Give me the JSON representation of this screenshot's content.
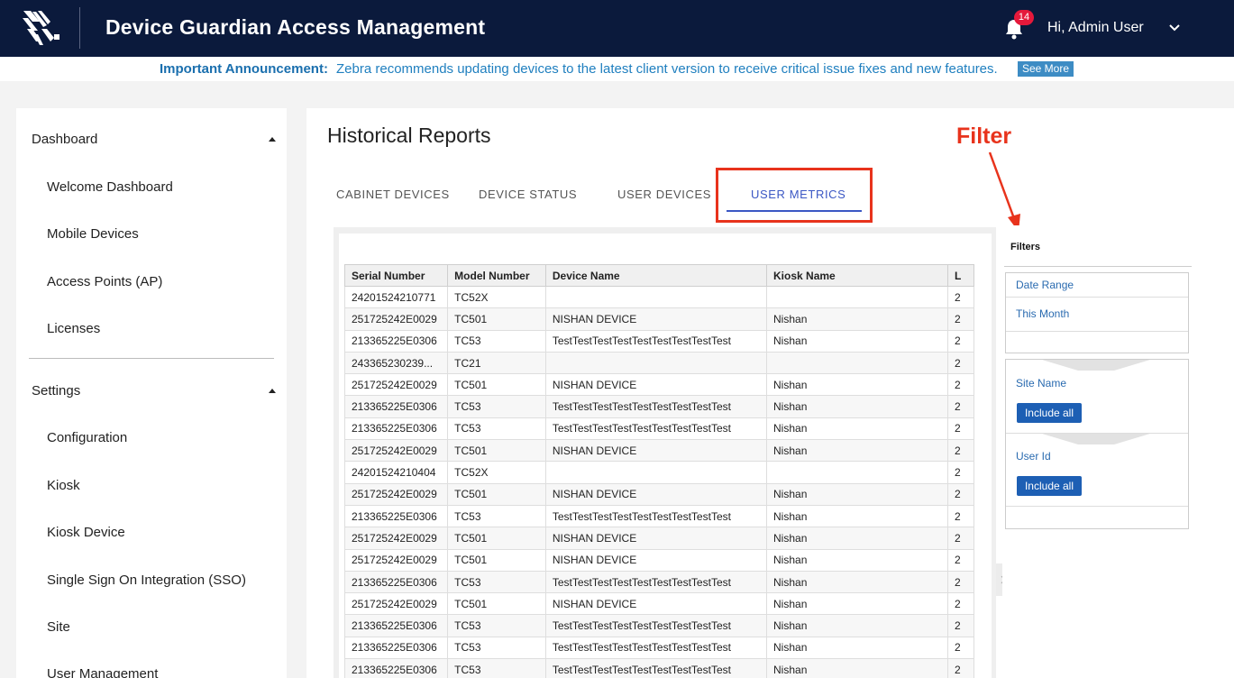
{
  "header": {
    "app_title": "Device Guardian Access Management",
    "notification_count": "14",
    "user_greeting": "Hi, Admin User",
    "logo_icon": "zebra-logo-icon"
  },
  "announcement": {
    "label": "Important Announcement:",
    "message": "Zebra recommends updating devices to the latest client version to receive critical issue fixes and new features.",
    "button": "See More"
  },
  "sidebar": {
    "dashboard_group": "Dashboard",
    "dashboard_items": [
      "Welcome Dashboard",
      "Mobile Devices",
      "Access Points (AP)",
      "Licenses"
    ],
    "settings_group": "Settings",
    "settings_items": [
      "Configuration",
      "Kiosk",
      "Kiosk Device",
      "Single Sign On Integration (SSO)",
      "Site",
      "User Management"
    ]
  },
  "main": {
    "page_title": "Historical Reports",
    "tabs": [
      "CABINET DEVICES",
      "DEVICE STATUS",
      "USER DEVICES",
      "USER METRICS"
    ],
    "active_tab": "USER METRICS",
    "annotation": "Filter"
  },
  "table": {
    "columns": [
      "Serial Number",
      "Model Number",
      "Device Name",
      "Kiosk Name",
      "L"
    ],
    "rows": [
      [
        "24201524210771",
        "TC52X",
        "",
        "",
        "2"
      ],
      [
        "251725242E0029",
        "TC501",
        "NISHAN DEVICE",
        "Nishan",
        "2"
      ],
      [
        "213365225E0306",
        "TC53",
        "TestTestTestTestTestTestTestTestTest",
        "Nishan",
        "2"
      ],
      [
        "243365230239...",
        "TC21",
        "",
        "",
        "2"
      ],
      [
        "251725242E0029",
        "TC501",
        "NISHAN DEVICE",
        "Nishan",
        "2"
      ],
      [
        "213365225E0306",
        "TC53",
        "TestTestTestTestTestTestTestTestTest",
        "Nishan",
        "2"
      ],
      [
        "213365225E0306",
        "TC53",
        "TestTestTestTestTestTestTestTestTest",
        "Nishan",
        "2"
      ],
      [
        "251725242E0029",
        "TC501",
        "NISHAN DEVICE",
        "Nishan",
        "2"
      ],
      [
        "24201524210404",
        "TC52X",
        "",
        "",
        "2"
      ],
      [
        "251725242E0029",
        "TC501",
        "NISHAN DEVICE",
        "Nishan",
        "2"
      ],
      [
        "213365225E0306",
        "TC53",
        "TestTestTestTestTestTestTestTestTest",
        "Nishan",
        "2"
      ],
      [
        "251725242E0029",
        "TC501",
        "NISHAN DEVICE",
        "Nishan",
        "2"
      ],
      [
        "251725242E0029",
        "TC501",
        "NISHAN DEVICE",
        "Nishan",
        "2"
      ],
      [
        "213365225E0306",
        "TC53",
        "TestTestTestTestTestTestTestTestTest",
        "Nishan",
        "2"
      ],
      [
        "251725242E0029",
        "TC501",
        "NISHAN DEVICE",
        "Nishan",
        "2"
      ],
      [
        "213365225E0306",
        "TC53",
        "TestTestTestTestTestTestTestTestTest",
        "Nishan",
        "2"
      ],
      [
        "213365225E0306",
        "TC53",
        "TestTestTestTestTestTestTestTestTest",
        "Nishan",
        "2"
      ],
      [
        "213365225E0306",
        "TC53",
        "TestTestTestTestTestTestTestTestTest",
        "Nishan",
        "2"
      ]
    ]
  },
  "filters": {
    "title": "Filters",
    "date_range_label": "Date Range",
    "date_range_value": "This Month",
    "site_name_label": "Site Name",
    "site_name_button": "Include all",
    "user_id_label": "User Id",
    "user_id_button": "Include all"
  },
  "colors": {
    "header_bg": "#0b1a3c",
    "accent": "#3b57c4",
    "annotation": "#e8331c",
    "badge": "#e5193b",
    "button": "#1d5fb4"
  }
}
